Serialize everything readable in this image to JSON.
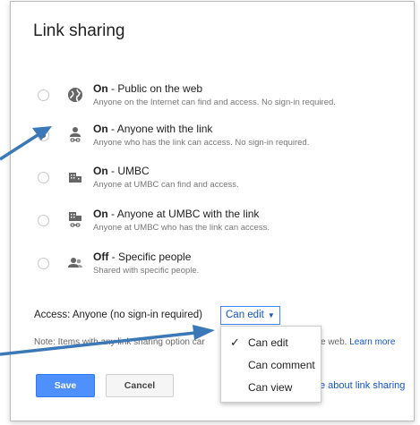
{
  "dialog": {
    "title": "Link sharing"
  },
  "options": [
    {
      "state": "On",
      "label": "Public on the web",
      "desc": "Anyone on the Internet can find and access. No sign-in required.",
      "icon": "globe-icon",
      "checked": false
    },
    {
      "state": "On",
      "label": "Anyone with the link",
      "desc": "Anyone who has the link can access. No sign-in required.",
      "icon": "person-link-icon",
      "checked": true
    },
    {
      "state": "On",
      "label": "UMBC",
      "desc": "Anyone at UMBC can find and access.",
      "icon": "building-icon",
      "checked": false
    },
    {
      "state": "On",
      "label": "Anyone at UMBC with the link",
      "desc": "Anyone at UMBC who has the link can access.",
      "icon": "building-link-icon",
      "checked": false
    },
    {
      "state": "Off",
      "label": "Specific people",
      "desc": "Shared with specific people.",
      "icon": "people-icon",
      "checked": false
    }
  ],
  "access": {
    "label": "Access:",
    "value": "Anyone (no sign-in required)",
    "selected": "Can edit"
  },
  "note": {
    "text": "Note: Items with any link sharing option car",
    "tail": "e web.",
    "learn_more": "Learn more"
  },
  "buttons": {
    "save": "Save",
    "cancel": "Cancel"
  },
  "learn_about": "e about link sharing",
  "menu": {
    "items": [
      {
        "label": "Can edit",
        "checked": true
      },
      {
        "label": "Can comment",
        "checked": false
      },
      {
        "label": "Can view",
        "checked": false
      }
    ]
  },
  "colors": {
    "accent": "#4d90fe",
    "link": "#1155cc",
    "arrow": "#3b78b8"
  }
}
